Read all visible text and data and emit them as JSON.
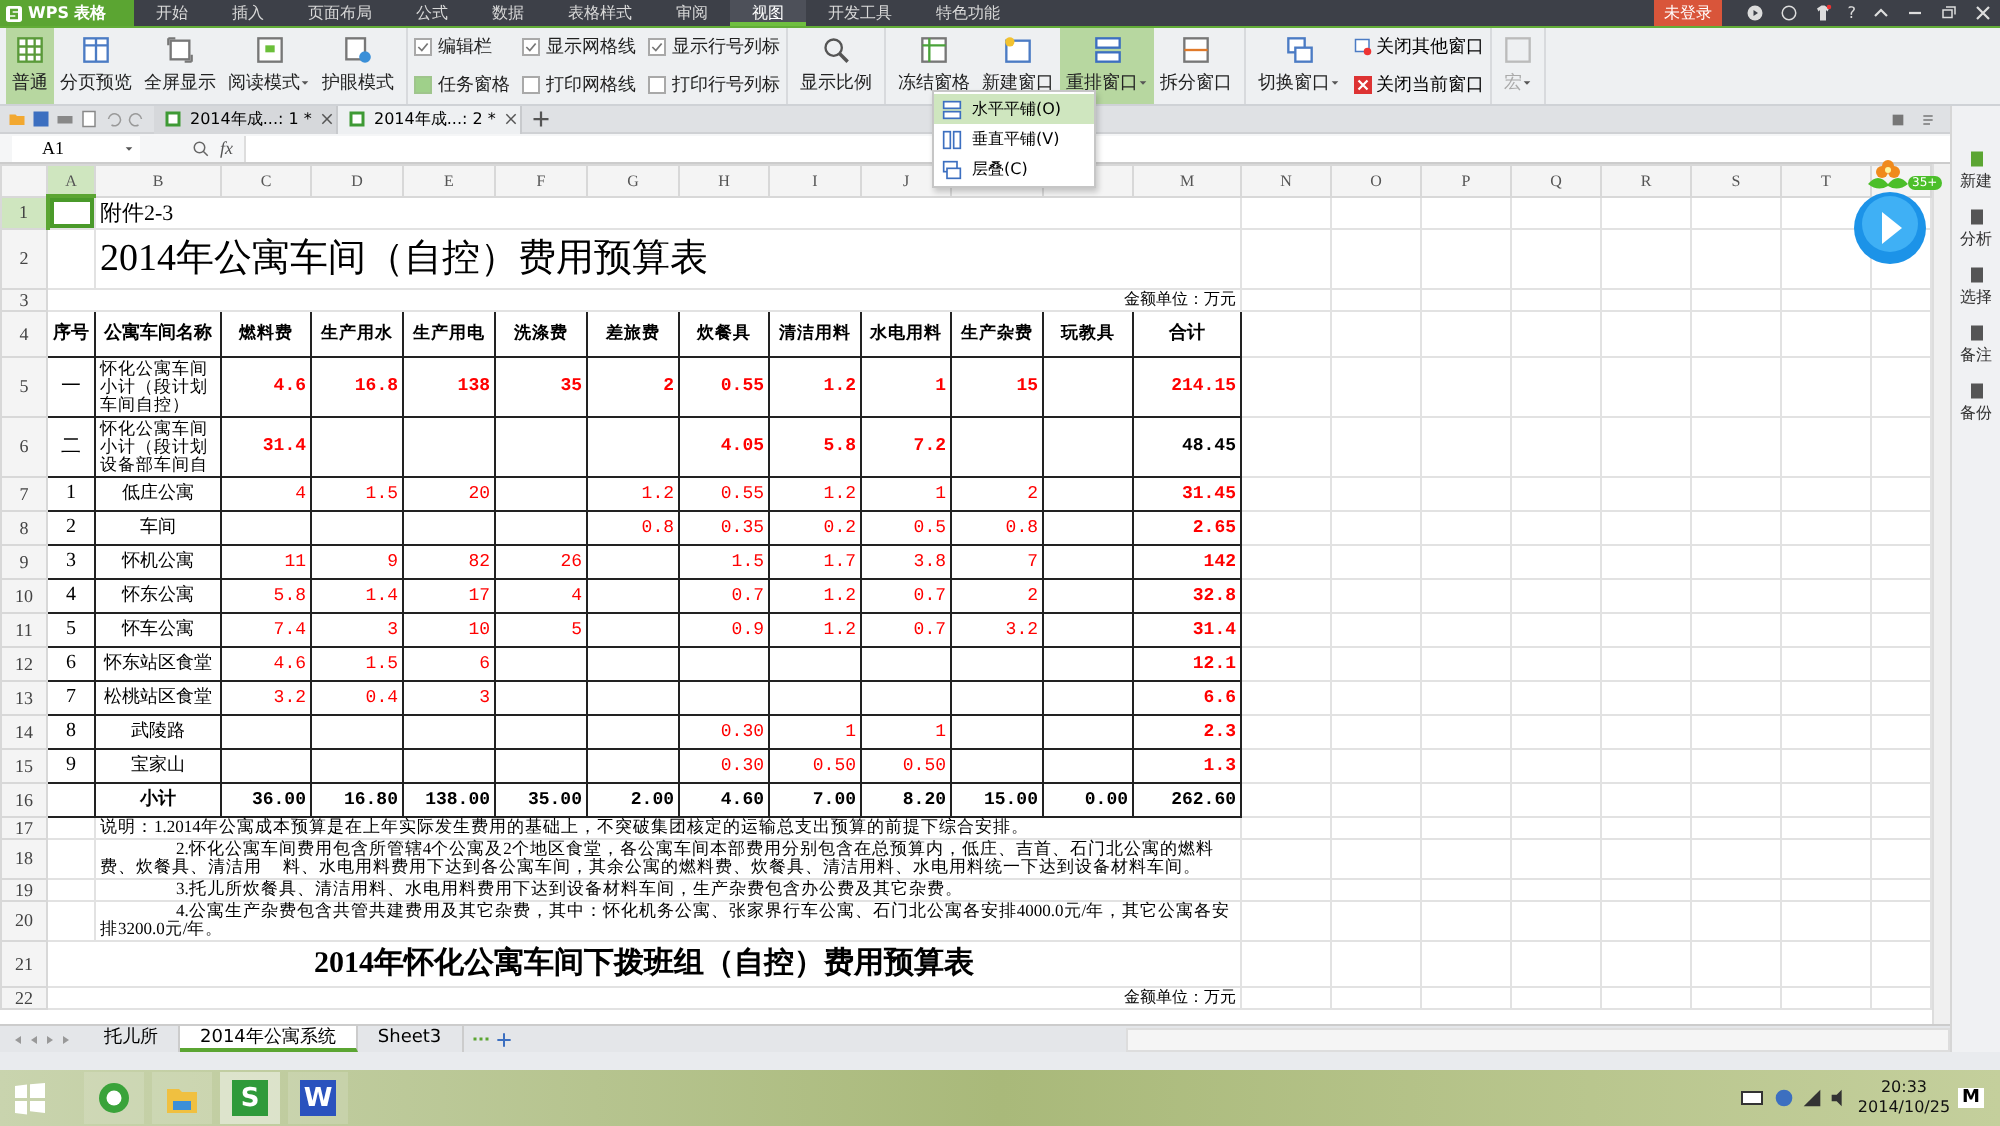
{
  "title_bar": {
    "app_name": "WPS 表格",
    "login": "未登录",
    "help": "?",
    "menus": [
      {
        "label": "开始",
        "selected": false
      },
      {
        "label": "插入",
        "selected": false
      },
      {
        "label": "页面布局",
        "selected": false
      },
      {
        "label": "公式",
        "selected": false
      },
      {
        "label": "数据",
        "selected": false
      },
      {
        "label": "表格样式",
        "selected": false
      },
      {
        "label": "审阅",
        "selected": false
      },
      {
        "label": "视图",
        "selected": true
      },
      {
        "label": "开发工具",
        "selected": false
      },
      {
        "label": "特色功能",
        "selected": false
      }
    ]
  },
  "ribbon": {
    "view_buttons": [
      {
        "label": "普通",
        "selected": true,
        "dropdown": false
      },
      {
        "label": "分页预览",
        "selected": false,
        "dropdown": false
      },
      {
        "label": "全屏显示",
        "selected": false,
        "dropdown": false
      },
      {
        "label": "阅读模式",
        "selected": false,
        "dropdown": true
      },
      {
        "label": "护眼模式",
        "selected": false,
        "dropdown": false
      }
    ],
    "toggles": [
      {
        "label": "编辑栏",
        "kind": "checkbox",
        "checked": true
      },
      {
        "label": "任务窗格",
        "kind": "pane",
        "checked": true
      },
      {
        "label": "显示网格线",
        "kind": "checkbox",
        "checked": true
      },
      {
        "label": "打印网格线",
        "kind": "checkbox",
        "checked": false
      },
      {
        "label": "显示行号列标",
        "kind": "checkbox",
        "checked": true
      },
      {
        "label": "打印行号列标",
        "kind": "checkbox",
        "checked": false
      }
    ],
    "zoom_button": "显示比例",
    "window_buttons": [
      {
        "label": "冻结窗格",
        "selected": false,
        "dropdown": false
      },
      {
        "label": "新建窗口",
        "selected": false,
        "dropdown": false
      },
      {
        "label": "重排窗口",
        "selected": true,
        "dropdown": true
      },
      {
        "label": "拆分窗口",
        "selected": false,
        "dropdown": false
      }
    ],
    "switch_button": {
      "label": "切换窗口",
      "dropdown": true
    },
    "close_buttons": [
      "关闭其他窗口",
      "关闭当前窗口"
    ],
    "macro": {
      "label": "宏",
      "disabled": true
    }
  },
  "arrange_menu": [
    {
      "label": "水平平铺(O)",
      "selected": true
    },
    {
      "label": "垂直平铺(V)",
      "selected": false
    },
    {
      "label": "层叠(C)",
      "selected": false
    }
  ],
  "documents": [
    {
      "label": "2014年成...: 1 *",
      "selected": false
    },
    {
      "label": "2014年成...: 2 *",
      "selected": true
    }
  ],
  "formula_bar": {
    "cell": "A1",
    "fx": "fx"
  },
  "sheet": {
    "columns": [
      {
        "letter": "A",
        "selected": true
      },
      {
        "letter": "B",
        "selected": false
      },
      {
        "letter": "C",
        "selected": false
      },
      {
        "letter": "D",
        "selected": false
      },
      {
        "letter": "E",
        "selected": false
      },
      {
        "letter": "F",
        "selected": false
      },
      {
        "letter": "G",
        "selected": false
      },
      {
        "letter": "H",
        "selected": false
      },
      {
        "letter": "I",
        "selected": false
      },
      {
        "letter": "J",
        "selected": false
      },
      {
        "selected": false
      },
      {
        "selected": false
      },
      {
        "letter": "M",
        "selected": false
      },
      {
        "letter": "N",
        "selected": false
      },
      {
        "letter": "O",
        "selected": false
      },
      {
        "letter": "P",
        "selected": false
      },
      {
        "letter": "Q",
        "selected": false
      },
      {
        "letter": "R",
        "selected": false
      },
      {
        "letter": "S",
        "selected": false
      },
      {
        "letter": "T",
        "selected": false
      }
    ],
    "rows": [
      {
        "number": "1",
        "selected": true,
        "kind": "attachment",
        "text": "附件2-3"
      },
      {
        "number": "2",
        "selected": false,
        "kind": "title",
        "text": "2014年公寓车间（自控）费用预算表"
      },
      {
        "number": "3",
        "selected": false,
        "kind": "unit",
        "text": "金额单位：万元"
      },
      {
        "number": "4",
        "selected": false,
        "kind": "header",
        "seq": "序号",
        "name": "公寓车间名称",
        "values": {
          "C": "燃料费",
          "D": "生产用水",
          "E": "生产用电",
          "F": "洗涤费",
          "G": "差旅费",
          "H": "炊餐具",
          "I": "清洁用料",
          "J": "水电用料",
          "K": "生产杂费",
          "L": "玩教具"
        },
        "total": "合计"
      },
      {
        "number": "5",
        "selected": false,
        "kind": "group",
        "seq": "一",
        "name": "怀化公寓车间小计（段计划车间自控）",
        "values": {
          "C": "4.6",
          "D": "16.8",
          "E": "138",
          "F": "35",
          "G": "2",
          "H": "0.55",
          "I": "1.2",
          "J": "1",
          "K": "15"
        },
        "total": "214.15",
        "alert": true
      },
      {
        "number": "6",
        "selected": false,
        "kind": "group",
        "seq": "二",
        "name": "怀化公寓车间小计（段计划设备部车间自",
        "values": {
          "C": "31.4",
          "H": "4.05",
          "I": "5.8",
          "J": "7.2"
        },
        "total": "48.45",
        "alert": false
      },
      {
        "number": "7",
        "selected": false,
        "kind": "data",
        "seq": "1",
        "name": "低庄公寓",
        "values": {
          "C": "4",
          "D": "1.5",
          "E": "20",
          "G": "1.2",
          "H": "0.55",
          "I": "1.2",
          "J": "1",
          "K": "2"
        },
        "total": "31.45",
        "alert": true
      },
      {
        "number": "8",
        "selected": false,
        "kind": "data",
        "seq": "2",
        "name": "车间",
        "values": {
          "G": "0.8",
          "H": "0.35",
          "I": "0.2",
          "J": "0.5",
          "K": "0.8"
        },
        "total": "2.65",
        "alert": true
      },
      {
        "number": "9",
        "selected": false,
        "kind": "data",
        "seq": "3",
        "name": "怀机公寓",
        "values": {
          "C": "11",
          "D": "9",
          "E": "82",
          "F": "26",
          "H": "1.5",
          "I": "1.7",
          "J": "3.8",
          "K": "7"
        },
        "total": "142",
        "alert": true
      },
      {
        "number": "10",
        "selected": false,
        "kind": "data",
        "seq": "4",
        "name": "怀东公寓",
        "values": {
          "C": "5.8",
          "D": "1.4",
          "E": "17",
          "F": "4",
          "H": "0.7",
          "I": "1.2",
          "J": "0.7",
          "K": "2"
        },
        "total": "32.8",
        "alert": true
      },
      {
        "number": "11",
        "selected": false,
        "kind": "data",
        "seq": "5",
        "name": "怀车公寓",
        "values": {
          "C": "7.4",
          "D": "3",
          "E": "10",
          "F": "5",
          "H": "0.9",
          "I": "1.2",
          "J": "0.7",
          "K": "3.2"
        },
        "total": "31.4",
        "alert": true
      },
      {
        "number": "12",
        "selected": false,
        "kind": "data",
        "seq": "6",
        "name": "怀东站区食堂",
        "values": {
          "C": "4.6",
          "D": "1.5",
          "E": "6"
        },
        "total": "12.1",
        "alert": true
      },
      {
        "number": "13",
        "selected": false,
        "kind": "data",
        "seq": "7",
        "name": "松桃站区食堂",
        "values": {
          "C": "3.2",
          "D": "0.4",
          "E": "3"
        },
        "total": "6.6",
        "alert": true
      },
      {
        "number": "14",
        "selected": false,
        "kind": "data",
        "seq": "8",
        "name": "武陵路",
        "values": {
          "H": "0.30",
          "I": "1",
          "J": "1"
        },
        "total": "2.3",
        "alert": true
      },
      {
        "number": "15",
        "selected": false,
        "kind": "data",
        "seq": "9",
        "name": "宝家山",
        "values": {
          "H": "0.30",
          "I": "0.50",
          "J": "0.50"
        },
        "total": "1.3",
        "alert": true
      },
      {
        "number": "16",
        "selected": false,
        "kind": "total",
        "name": "小计",
        "values": {
          "C": "36.00",
          "D": "16.80",
          "E": "138.00",
          "F": "35.00",
          "G": "2.00",
          "H": "4.60",
          "I": "7.00",
          "J": "8.20",
          "K": "15.00",
          "L": "0.00"
        },
        "total": "262.60"
      },
      {
        "number": "17",
        "selected": false,
        "kind": "note",
        "indent": false,
        "text": "说明：1.2014年公寓成本预算是在上年实际发生费用的基础上，不突破集团核定的运输总支出预算的前提下综合安排。"
      },
      {
        "number": "18",
        "selected": false,
        "kind": "note",
        "indent": true,
        "text": "2.怀化公寓车间费用包含所管辖4个公寓及2个地区食堂，各公寓车间本部费用分别包含在总预算内，低庄、吉首、石门北公寓的燃料费、炊餐具、清洁用     料、水电用料费用下达到各公寓车间，其余公寓的燃料费、炊餐具、清洁用料、水电用料统一下达到设备材料车间。"
      },
      {
        "number": "19",
        "selected": false,
        "kind": "note",
        "indent": true,
        "text": "3.托儿所炊餐具、清洁用料、水电用料费用下达到设备材料车间，生产杂费包含办公费及其它杂费。"
      },
      {
        "number": "20",
        "selected": false,
        "kind": "note",
        "indent": true,
        "text": "4.公寓生产杂费包含共管共建费用及其它杂费，其中：怀化机务公寓、张家界行车公寓、石门北公寓各安排4000.0元/年，其它公寓各安排3200.0元/年。"
      },
      {
        "number": "21",
        "selected": false,
        "kind": "subtitle",
        "text": "2014年怀化公寓车间下拨班组（自控）费用预算表"
      },
      {
        "number": "22",
        "selected": false,
        "kind": "unit",
        "text": "金额单位：万元"
      }
    ]
  },
  "sheet_tabs": [
    {
      "label": "托儿所",
      "selected": false
    },
    {
      "label": "2014年公寓系统",
      "selected": true
    },
    {
      "label": "Sheet3",
      "selected": false
    }
  ],
  "sidebar": [
    "新建",
    "分析",
    "选择",
    "备注",
    "备份"
  ],
  "assistant_badge": "35+",
  "taskbar": {
    "apps": [
      {
        "selected": false
      },
      {
        "selected": false
      },
      {
        "selected": true,
        "letter": "S"
      },
      {
        "selected": false,
        "letter": "W"
      }
    ],
    "ime": "M",
    "time": "20:33",
    "date": "2014/10/25"
  }
}
